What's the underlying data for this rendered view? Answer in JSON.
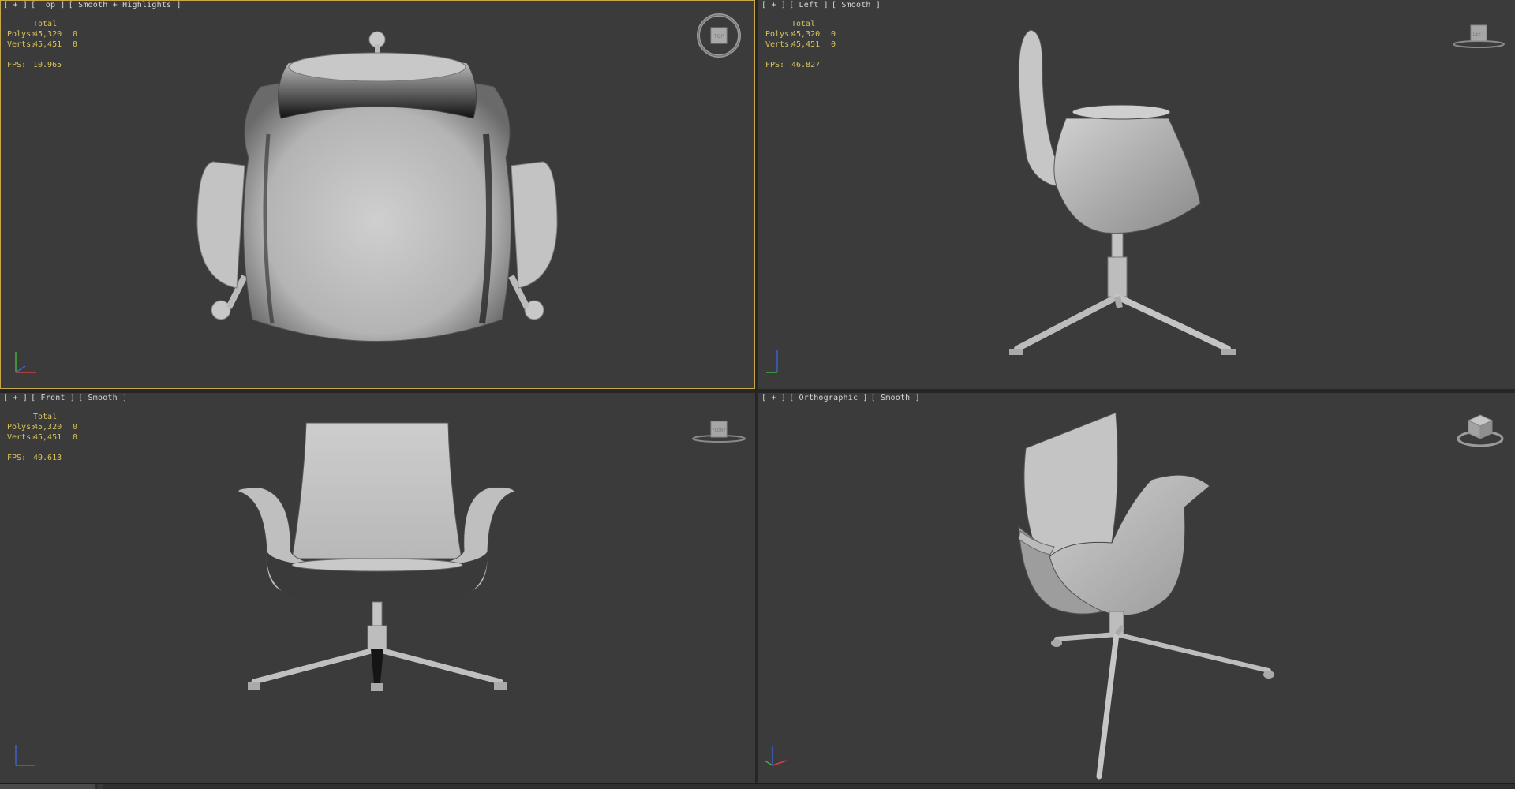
{
  "viewports": {
    "top": {
      "label": [
        "[ + ]",
        "[ Top ]",
        "[ Smooth + Highlights ]"
      ],
      "total": "Total",
      "polys_label": "Polys:",
      "polys_value": "45,320",
      "polys_sel": "0",
      "verts_label": "Verts:",
      "verts_value": "45,451",
      "verts_sel": "0",
      "fps_label": "FPS:",
      "fps_value": "10.965",
      "viewcube_label": "TOP"
    },
    "left": {
      "label": [
        "[ + ]",
        "[ Left ]",
        "[ Smooth ]"
      ],
      "total": "Total",
      "polys_label": "Polys:",
      "polys_value": "45,320",
      "polys_sel": "0",
      "verts_label": "Verts:",
      "verts_value": "45,451",
      "verts_sel": "0",
      "fps_label": "FPS:",
      "fps_value": "46.827",
      "viewcube_label": "LEFT"
    },
    "front": {
      "label": [
        "[ + ]",
        "[ Front ]",
        "[ Smooth ]"
      ],
      "total": "Total",
      "polys_label": "Polys:",
      "polys_value": "45,320",
      "polys_sel": "0",
      "verts_label": "Verts:",
      "verts_value": "45,451",
      "verts_sel": "0",
      "fps_label": "FPS:",
      "fps_value": "49.613",
      "viewcube_label": "FRONT"
    },
    "ortho": {
      "label": [
        "[ + ]",
        "[ Orthographic ]",
        "[ Smooth ]"
      ]
    }
  },
  "colors": {
    "viewport_bg": "#3b3b3b",
    "stats_text": "#d9c45a",
    "active_border": "#c8a84a",
    "model": "#bdbdbd"
  }
}
